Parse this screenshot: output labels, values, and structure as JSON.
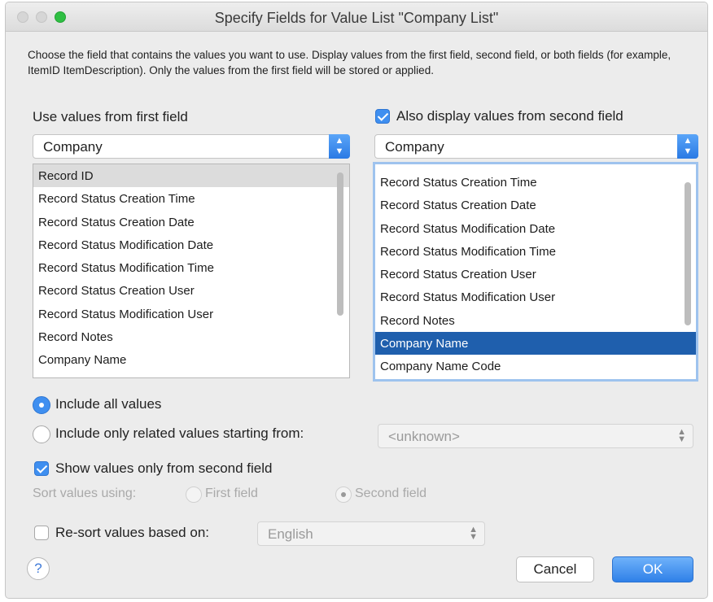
{
  "window": {
    "title": "Specify Fields for Value List \"Company List\""
  },
  "description": "Choose the field that contains the values you want to use.  Display values from the first field, second field, or both fields (for example, ItemID ItemDescription). Only the values from the first field will be stored or applied.",
  "first_field": {
    "label": "Use values from first field",
    "table": "Company",
    "items": [
      "Record ID",
      "Record Status Creation Time",
      "Record Status Creation Date",
      "Record Status Modification Date",
      "Record Status Modification Time",
      "Record Status Creation User",
      "Record Status Modification User",
      "Record Notes",
      "Company Name"
    ],
    "selected_index": 0
  },
  "second_field": {
    "label": "Also display values from second field",
    "checked": true,
    "table": "Company",
    "items": [
      "Record Status Creation Time",
      "Record Status Creation Date",
      "Record Status Modification Date",
      "Record Status Modification Time",
      "Record Status Creation User",
      "Record Status Modification User",
      "Record Notes",
      "Company Name",
      "Company Name Code"
    ],
    "selected_index": 7
  },
  "include": {
    "all_label": "Include all values",
    "related_label": "Include only related values starting from:",
    "related_value": "<unknown>",
    "selected": "all"
  },
  "show_second_only": {
    "label": "Show values only from second field",
    "checked": true
  },
  "sort": {
    "label": "Sort values using:",
    "first_label": "First field",
    "second_label": "Second field",
    "selected": "second"
  },
  "resort": {
    "label": "Re-sort values based on:",
    "checked": false,
    "language": "English"
  },
  "buttons": {
    "help": "?",
    "cancel": "Cancel",
    "ok": "OK"
  },
  "colors": {
    "accent": "#3f8ff0",
    "selection": "#1f5fad"
  }
}
